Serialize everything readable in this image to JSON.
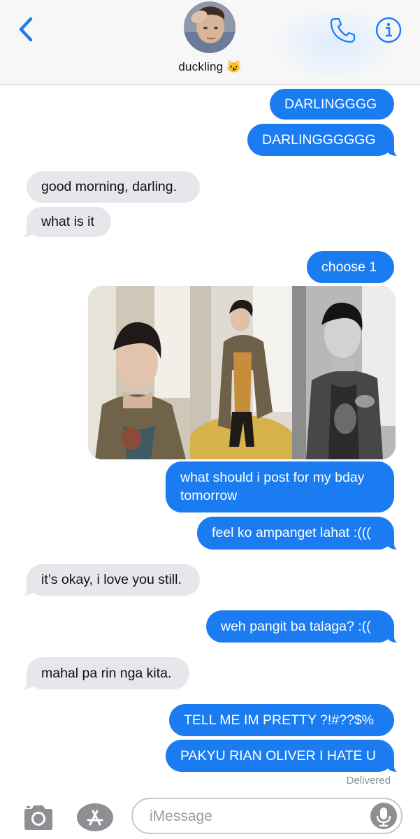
{
  "header": {
    "contact_name": "duckling 😼"
  },
  "messages": [
    {
      "id": "m1",
      "direction": "outgoing",
      "text": "DARLINGGGG"
    },
    {
      "id": "m2",
      "direction": "outgoing",
      "text": "DARLINGGGGGG"
    },
    {
      "id": "m3",
      "direction": "incoming",
      "text": "good morning, darling."
    },
    {
      "id": "m4",
      "direction": "incoming",
      "text": "what is it"
    },
    {
      "id": "m5",
      "direction": "outgoing",
      "text": "choose 1"
    },
    {
      "id": "m6",
      "direction": "outgoing",
      "text": "what should i post for my bday tomorrow",
      "line1": "what should i post for my bday",
      "line2": "tomorrow"
    },
    {
      "id": "m7",
      "direction": "outgoing",
      "text": "feel ko ampanget lahat :((("
    },
    {
      "id": "m8",
      "direction": "incoming",
      "text": "it’s okay, i love you still."
    },
    {
      "id": "m9",
      "direction": "outgoing",
      "text": "weh pangit ba talaga? :(("
    },
    {
      "id": "m10",
      "direction": "incoming",
      "text": "mahal pa rin nga kita."
    },
    {
      "id": "m11",
      "direction": "outgoing",
      "text": "TELL ME IM PRETTY ?!#??$%"
    },
    {
      "id": "m12",
      "direction": "outgoing",
      "text": "PAKYU RIAN OLIVER I HATE U"
    }
  ],
  "delivered_status": "Delivered",
  "compose": {
    "placeholder": "iMessage"
  },
  "colors": {
    "outgoing_bubble": "#1b7cf2",
    "incoming_bubble": "#e7e7eb",
    "accent": "#1b7cf2"
  },
  "icons": [
    "chevron-left-icon",
    "phone-icon",
    "info-icon",
    "camera-icon",
    "app-store-icon",
    "microphone-icon"
  ]
}
